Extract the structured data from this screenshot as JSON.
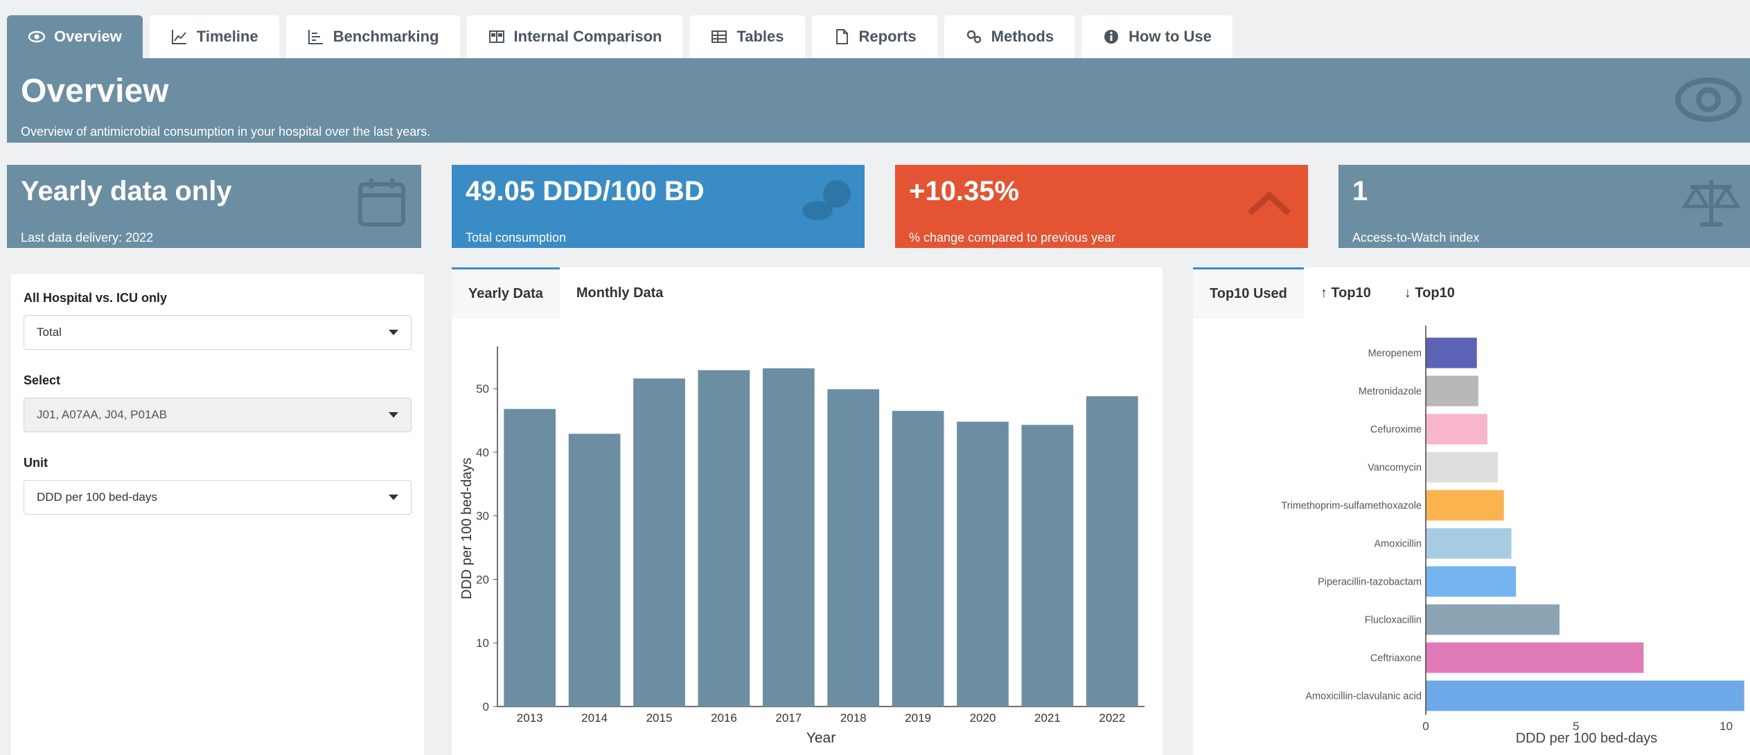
{
  "nav": {
    "tabs": [
      {
        "label": "Overview",
        "icon": "eye-icon"
      },
      {
        "label": "Timeline",
        "icon": "line-chart-icon"
      },
      {
        "label": "Benchmarking",
        "icon": "bar-chart-icon"
      },
      {
        "label": "Internal Comparison",
        "icon": "columns-icon"
      },
      {
        "label": "Tables",
        "icon": "table-icon"
      },
      {
        "label": "Reports",
        "icon": "file-icon"
      },
      {
        "label": "Methods",
        "icon": "cogs-icon"
      },
      {
        "label": "How to Use",
        "icon": "info-circle-icon"
      }
    ]
  },
  "header": {
    "title": "Overview",
    "subtitle": "Overview of antimicrobial consumption in your hospital over the last years."
  },
  "value_boxes": [
    {
      "value": "Yearly data only",
      "label": "Last data delivery: 2022",
      "icon": "calendar-icon",
      "color": "#6b8ea3"
    },
    {
      "value": "49.05 DDD/100 BD",
      "label": "Total consumption",
      "icon": "pills-icon",
      "color": "#3a8cc6"
    },
    {
      "value": "+10.35%",
      "label": "% change compared to previous year",
      "icon": "chevron-up-icon",
      "color": "#e45432"
    },
    {
      "value": "1",
      "label": "Access-to-Watch index",
      "icon": "balance-scale-icon",
      "color": "#6b8ea3"
    }
  ],
  "sidebar": {
    "scope": {
      "label": "All Hospital vs. ICU only",
      "value": "Total"
    },
    "select": {
      "label": "Select",
      "value": "J01, A07AA, J04, P01AB"
    },
    "unit": {
      "label": "Unit",
      "value": "DDD per 100 bed-days"
    }
  },
  "mid_panel": {
    "tabs": [
      "Yearly Data",
      "Monthly Data"
    ]
  },
  "right_panel": {
    "tabs": [
      "Top10 Used",
      "↑ Top10",
      "↓ Top10"
    ]
  },
  "chart_data": [
    {
      "type": "bar",
      "orientation": "vertical",
      "categories": [
        "2013",
        "2014",
        "2015",
        "2016",
        "2017",
        "2018",
        "2019",
        "2020",
        "2021",
        "2022"
      ],
      "values": [
        46.8,
        42.9,
        51.6,
        52.9,
        53.2,
        49.9,
        46.5,
        44.8,
        44.3,
        48.8
      ],
      "xlabel": "Year",
      "ylabel": "DDD per 100 bed-days",
      "ylim": [
        0,
        56
      ],
      "yticks": [
        0,
        10,
        20,
        30,
        40,
        50
      ],
      "color": "#6b8ea3"
    },
    {
      "type": "bar",
      "orientation": "horizontal",
      "categories": [
        "Meropenem",
        "Metronidazole",
        "Cefuroxime",
        "Vancomycin",
        "Trimethoprim-sulfamethoxazole",
        "Amoxicillin",
        "Piperacillin-tazobactam",
        "Flucloxacillin",
        "Ceftriaxone",
        "Amoxicillin-clavulanic acid"
      ],
      "values": [
        1.7,
        1.75,
        2.05,
        2.4,
        2.6,
        2.85,
        3.0,
        4.45,
        7.25,
        10.6
      ],
      "colors": [
        "#5c62b5",
        "#b8b8b8",
        "#f7b6cc",
        "#dedede",
        "#fbb34f",
        "#a8cbe4",
        "#74b4f0",
        "#8ba3b3",
        "#e07bb8",
        "#6da9e8"
      ],
      "xlabel": "DDD per 100 bed-days",
      "xlim": [
        0,
        10.7
      ],
      "xticks": [
        0,
        5,
        10
      ]
    }
  ]
}
